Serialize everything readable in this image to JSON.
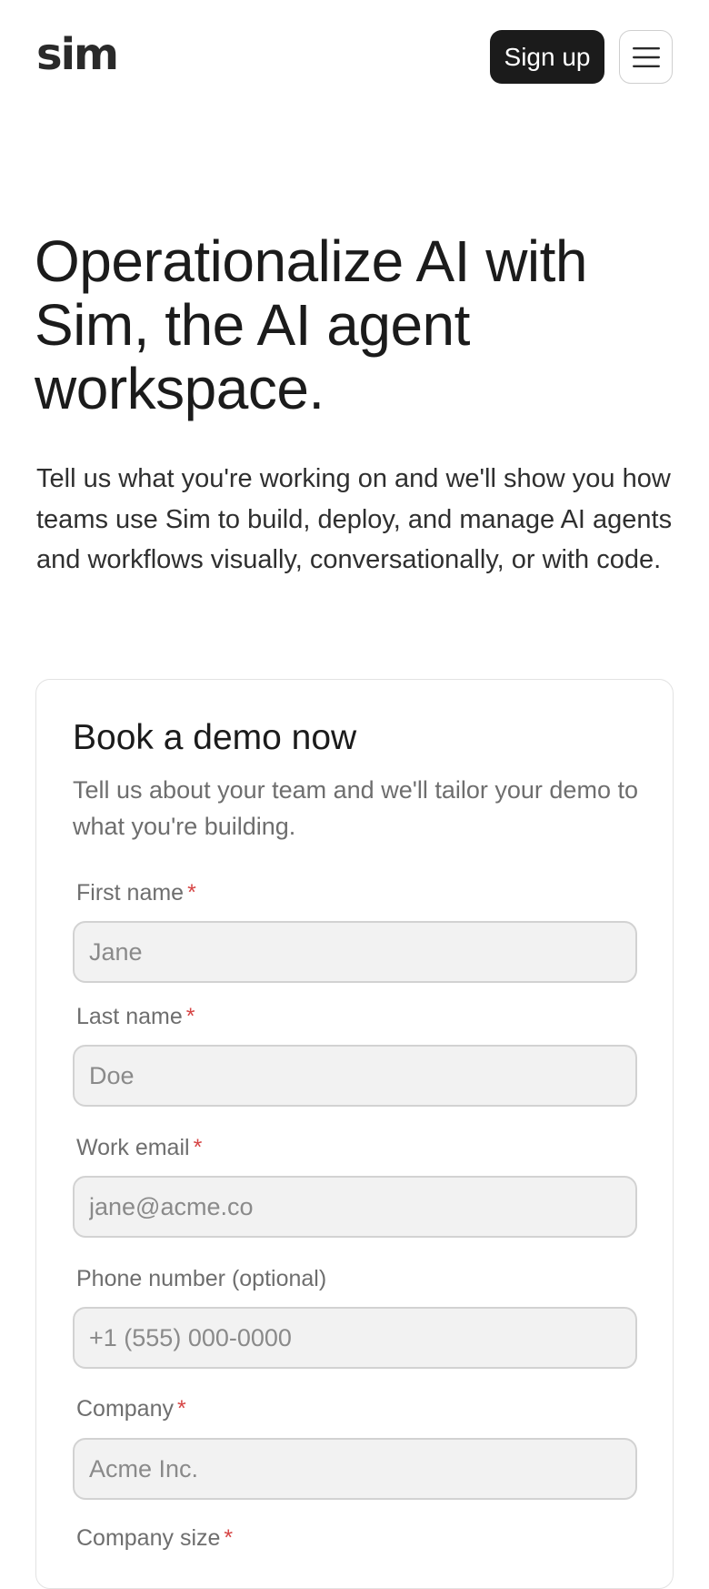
{
  "header": {
    "logo": "sim",
    "signup_label": "Sign up",
    "menu_icon": "hamburger-menu-icon"
  },
  "hero": {
    "title": "Operationalize AI with Sim, the AI agent workspace.",
    "subtitle": "Tell us what you're working on and we'll show you how teams use Sim to build, deploy, and manage AI agents and workflows visually, conversationally, or with code."
  },
  "form": {
    "title": "Book a demo now",
    "subtitle": "Tell us about your team and we'll tailor your demo to what you're building.",
    "required_marker": "*",
    "fields": [
      {
        "label": "First name",
        "placeholder": "Jane",
        "value": "",
        "required": true
      },
      {
        "label": "Last name",
        "placeholder": "Doe",
        "value": "",
        "required": true
      },
      {
        "label": "Work email",
        "placeholder": "jane@acme.co",
        "value": "",
        "required": true
      },
      {
        "label": "Phone number (optional)",
        "placeholder": "+1 (555) 000-0000",
        "value": "",
        "required": false
      },
      {
        "label": "Company",
        "placeholder": "Acme Inc.",
        "value": "",
        "required": true
      },
      {
        "label": "Company size",
        "placeholder": "",
        "value": "",
        "required": true
      }
    ]
  },
  "colors": {
    "primary": "#1b1b1b",
    "required": "#d64545",
    "input_bg": "#f2f2f2",
    "muted_text": "#6e6e6e"
  }
}
